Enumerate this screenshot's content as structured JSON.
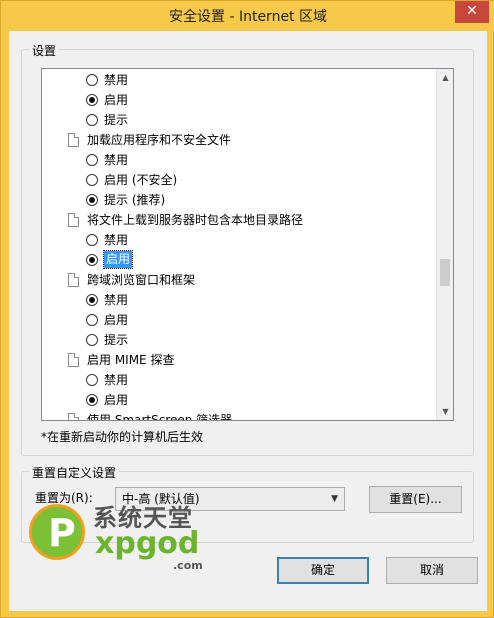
{
  "window": {
    "title": "安全设置 - Internet 区域",
    "close_glyph": "✕"
  },
  "settings_group": {
    "label": "设置"
  },
  "list": {
    "rows": [
      {
        "type": "option",
        "label": "禁用",
        "checked": false
      },
      {
        "type": "option",
        "label": "启用",
        "checked": true
      },
      {
        "type": "option",
        "label": "提示",
        "checked": false
      },
      {
        "type": "category",
        "label": "加载应用程序和不安全文件"
      },
      {
        "type": "option",
        "label": "禁用",
        "checked": false
      },
      {
        "type": "option",
        "label": "启用 (不安全)",
        "checked": false
      },
      {
        "type": "option",
        "label": "提示 (推荐)",
        "checked": true
      },
      {
        "type": "category",
        "label": "将文件上载到服务器时包含本地目录路径"
      },
      {
        "type": "option",
        "label": "禁用",
        "checked": false
      },
      {
        "type": "option",
        "label": "启用",
        "checked": true,
        "selected": true
      },
      {
        "type": "category",
        "label": "跨域浏览窗口和框架"
      },
      {
        "type": "option",
        "label": "禁用",
        "checked": true
      },
      {
        "type": "option",
        "label": "启用",
        "checked": false
      },
      {
        "type": "option",
        "label": "提示",
        "checked": false
      },
      {
        "type": "category",
        "label": "启用 MIME 探查"
      },
      {
        "type": "option",
        "label": "禁用",
        "checked": false
      },
      {
        "type": "option",
        "label": "启用",
        "checked": true
      },
      {
        "type": "category",
        "label": "使用 SmartScreen 筛选器"
      }
    ],
    "scroll_up_glyph": "▲",
    "scroll_down_glyph": "▼"
  },
  "note": "*在重新启动你的计算机后生效",
  "reset_group": {
    "label": "重置自定义设置",
    "reset_to_label": "重置为(R):",
    "selected_level": "中-高 (默认值)",
    "reset_button": "重置(E)..."
  },
  "footer": {
    "ok_button": "确定",
    "cancel_button": "取消"
  },
  "watermark": {
    "cn_text": "系统天堂",
    "en_text": "xpgod",
    "com_text": ".com"
  }
}
